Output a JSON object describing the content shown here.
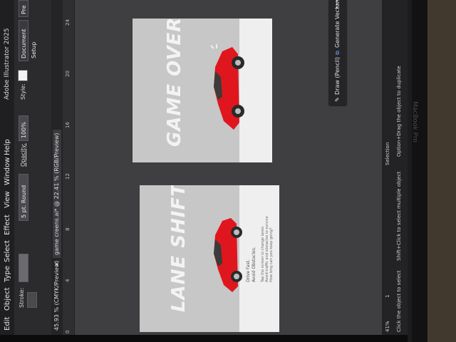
{
  "menu": {
    "items": [
      "Edit",
      "Object",
      "Type",
      "Select",
      "Effect",
      "View",
      "Window",
      "Help"
    ],
    "app_title": "Adobe Illustrator 2025"
  },
  "control_bar": {
    "stroke_label": "Stroke:",
    "brush_value": "5 pt. Round",
    "opacity_label": "Opacity:",
    "opacity_value": "100%",
    "style_label": "Style:",
    "document_setup": "Document Setup",
    "preferences": "Pre"
  },
  "tabs": [
    {
      "label": "45.93 % (CMYK/Preview)"
    },
    {
      "label": "game creens.ai* @ 22.41 % (RGB/Preview)"
    }
  ],
  "ruler": {
    "ticks": [
      "0",
      "4",
      "8",
      "12",
      "16",
      "20",
      "24"
    ]
  },
  "artboards": {
    "game_over": {
      "title": "GAME OVER"
    },
    "lane_shift": {
      "title": "LANE SHIFT",
      "lines": [
        "Drive Fast.",
        "Avoid Obstacles.",
        "Tap the screen to change lanes",
        "Avoid traffic and obstacles to survive",
        "How long can you keep going?"
      ]
    }
  },
  "floating_toolbar": {
    "draw_label": "Draw (Pencil)",
    "generate_label": "Generate Vectors",
    "more": "•••"
  },
  "status_bar": {
    "zoom": "41%",
    "page": "1",
    "hint_1": "Click the object to select",
    "hint_2": "Shift+Click to select multiple object",
    "hint_3": "Option+Drag the object to duplicate",
    "mode": "Selection"
  },
  "device": {
    "brand": "MacBook Pro"
  },
  "colors": {
    "car_red": "#e0161e",
    "ui_dark": "#2b2b2e",
    "canvas": "#3f3f42",
    "artboard": "#c7c7c7"
  }
}
